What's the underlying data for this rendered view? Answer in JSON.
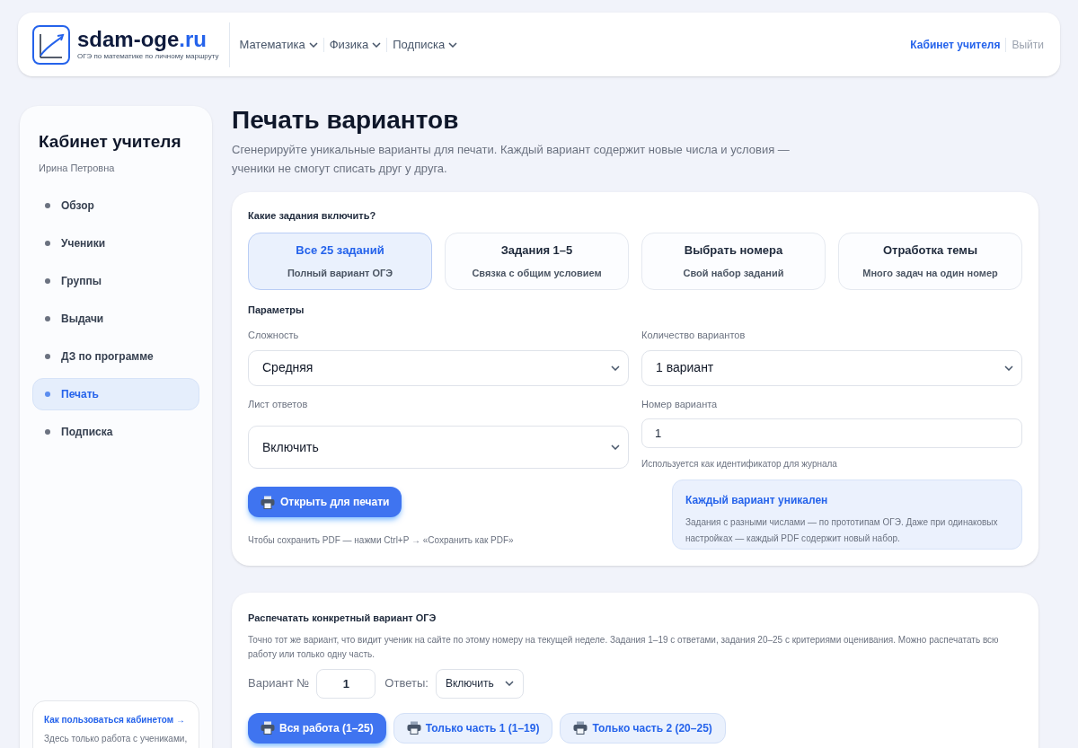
{
  "header": {
    "logo": {
      "name": "sdam-oge",
      "tld": ".ru",
      "tagline": "ОГЭ по математике по личному маршруту"
    },
    "nav": [
      {
        "label": "Математика"
      },
      {
        "label": "Физика"
      },
      {
        "label": "Подписка"
      }
    ],
    "account": [
      {
        "label": "Кабинет учителя",
        "kind": "active"
      },
      {
        "label": "Выйти",
        "kind": "muted"
      }
    ]
  },
  "sidebar": {
    "title": "Кабинет учителя",
    "user": "Ирина Петровна",
    "items": [
      {
        "label": "Обзор",
        "selected": false
      },
      {
        "label": "Ученики",
        "selected": false
      },
      {
        "label": "Группы",
        "selected": false
      },
      {
        "label": "Выдачи",
        "selected": false
      },
      {
        "label": "ДЗ по программе",
        "selected": false
      },
      {
        "label": "Печать",
        "selected": true
      },
      {
        "label": "Подписка",
        "selected": false
      }
    ],
    "help": {
      "title": "Как пользоваться кабинетом →",
      "text": "Здесь только работа с учениками,"
    }
  },
  "page": {
    "title": "Печать вариантов",
    "subtitle": "Сгенерируйте уникальные варианты для печати. Каждый вариант содержит новые числа и условия — ученики не смогут списать друг у друга."
  },
  "generator": {
    "question": "Какие задания включить?",
    "modes": [
      {
        "title": "Все 25 заданий",
        "subtitle": "Полный вариант ОГЭ",
        "selected": true
      },
      {
        "title": "Задания 1–5",
        "subtitle": "Связка с общим условием",
        "selected": false
      },
      {
        "title": "Выбрать номера",
        "subtitle": "Свой набор заданий",
        "selected": false
      },
      {
        "title": "Отработка темы",
        "subtitle": "Много задач на один номер",
        "selected": false
      }
    ],
    "params_title": "Параметры",
    "difficulty": {
      "label": "Сложность",
      "value": "Средняя"
    },
    "count": {
      "label": "Количество вариантов",
      "value": "1 вариант"
    },
    "answers": {
      "label": "Лист ответов",
      "value": "Включить"
    },
    "number": {
      "label": "Номер варианта",
      "value": "1",
      "hint": "Используется как идентификатор для журнала"
    },
    "print_button": "Открыть для печати",
    "pdf_hint": "Чтобы сохранить PDF — нажми Ctrl+P → «Сохранить как PDF»",
    "note": {
      "title": "Каждый вариант уникален",
      "text": "Задания с разными числами — по прототипам ОГЭ. Даже при одинаковых настройках — каждый PDF содержит новый набор."
    }
  },
  "specific": {
    "title": "Распечатать конкретный вариант ОГЭ",
    "text": "Точно тот же вариант, что видит ученик на сайте по этому номеру на текущей неделе. Задания 1–19 с ответами, задания 20–25 с критериями оценивания. Можно распечатать всю работу или только одну часть.",
    "variant_label": "Вариант №",
    "variant_value": "1",
    "answers_label": "Ответы:",
    "answers_value": "Включить",
    "buttons": [
      {
        "label": "Вся работа (1–25)",
        "selected": true
      },
      {
        "label": "Только часть 1 (1–19)",
        "selected": false
      },
      {
        "label": "Только часть 2 (20–25)",
        "selected": false
      }
    ]
  }
}
